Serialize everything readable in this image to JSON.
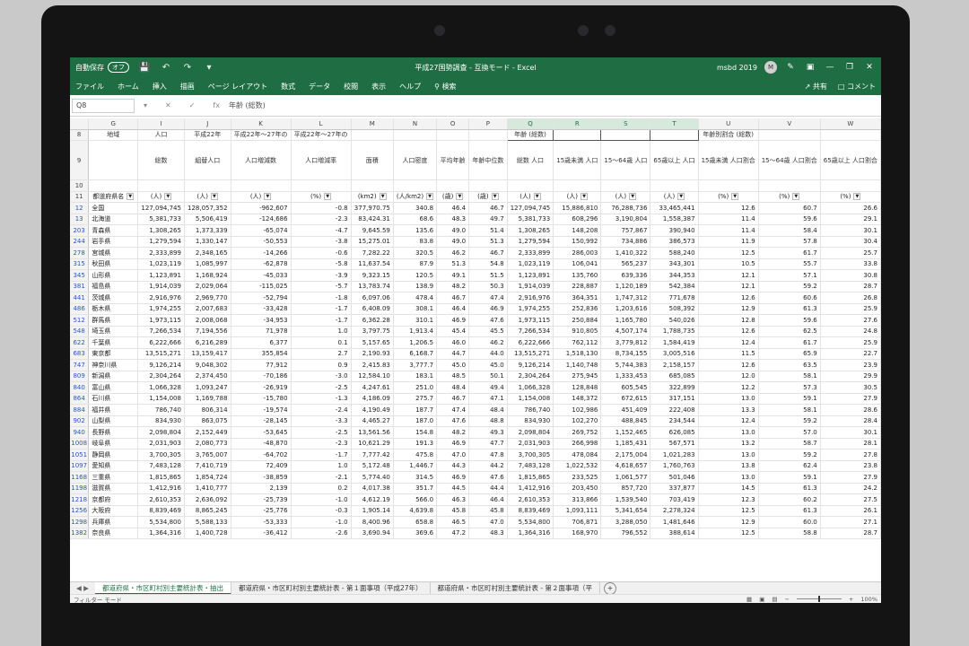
{
  "titlebar": {
    "autosave_label": "自動保存",
    "autosave_state": "オフ",
    "title": "平成27国勢調査 - 互換モード - Excel",
    "account": "msbd 2019",
    "avatar": "M"
  },
  "menu": {
    "items": [
      "ファイル",
      "ホーム",
      "挿入",
      "描画",
      "ページ レイアウト",
      "数式",
      "データ",
      "校閲",
      "表示",
      "ヘルプ",
      "検索"
    ],
    "share": "共有",
    "comment": "コメント"
  },
  "formula_bar": {
    "cell_ref": "Q8",
    "fx": "fx",
    "content": "年齢 (総数)"
  },
  "columns": [
    "G",
    "I",
    "J",
    "K",
    "L",
    "M",
    "N",
    "O",
    "P",
    "Q",
    "R",
    "S",
    "T",
    "U",
    "V",
    "W"
  ],
  "selected_columns": [
    "Q",
    "R",
    "S",
    "T"
  ],
  "header_rows": {
    "row8": {
      "num": "8",
      "cells": [
        "地域",
        "人口",
        "平成22年",
        "平成22年～27年の",
        "平成22年～27年の",
        "",
        "",
        "",
        "",
        "年齢 (総数)",
        "",
        "",
        "",
        "年齢別割合 (総数)",
        "",
        ""
      ]
    },
    "row9": {
      "num": "9",
      "cells": [
        "",
        "総数",
        "組替人口",
        "人口増減数",
        "人口増減率",
        "面積",
        "人口密度",
        "平均年齢",
        "年齢中位数",
        "総数 人口",
        "15歳未満 人口",
        "15～64歳 人口",
        "65歳以上 人口",
        "15歳未満 人口割合",
        "15～64歳 人口割合",
        "65歳以上 人口割合"
      ]
    },
    "row10": {
      "num": "10"
    },
    "row11": {
      "num": "11",
      "cells": [
        "都道府県名",
        "(人)",
        "(人)",
        "(人)",
        "(%)",
        "(km2)",
        "(人/km2)",
        "(歳)",
        "(歳)",
        "(人)",
        "(人)",
        "(人)",
        "(人)",
        "(%)",
        "(%)",
        "(%)"
      ]
    }
  },
  "rows": [
    [
      "12",
      "全国",
      "127,094,745",
      "128,057,352",
      "-962,607",
      "-0.8",
      "377,970.75",
      "340.8",
      "46.4",
      "46.7",
      "127,094,745",
      "15,886,810",
      "76,288,736",
      "33,465,441",
      "12.6",
      "60.7",
      "26.6"
    ],
    [
      "13",
      "北海道",
      "5,381,733",
      "5,506,419",
      "-124,686",
      "-2.3",
      "83,424.31",
      "68.6",
      "48.3",
      "49.7",
      "5,381,733",
      "608,296",
      "3,190,804",
      "1,558,387",
      "11.4",
      "59.6",
      "29.1"
    ],
    [
      "203",
      "青森県",
      "1,308,265",
      "1,373,339",
      "-65,074",
      "-4.7",
      "9,645.59",
      "135.6",
      "49.0",
      "51.4",
      "1,308,265",
      "148,208",
      "757,867",
      "390,940",
      "11.4",
      "58.4",
      "30.1"
    ],
    [
      "244",
      "岩手県",
      "1,279,594",
      "1,330,147",
      "-50,553",
      "-3.8",
      "15,275.01",
      "83.8",
      "49.0",
      "51.3",
      "1,279,594",
      "150,992",
      "734,886",
      "386,573",
      "11.9",
      "57.8",
      "30.4"
    ],
    [
      "278",
      "宮城県",
      "2,333,899",
      "2,348,165",
      "-14,266",
      "-0.6",
      "7,282.22",
      "320.5",
      "46.2",
      "46.7",
      "2,333,899",
      "286,003",
      "1,410,322",
      "588,240",
      "12.5",
      "61.7",
      "25.7"
    ],
    [
      "315",
      "秋田県",
      "1,023,119",
      "1,085,997",
      "-62,878",
      "-5.8",
      "11,637.54",
      "87.9",
      "51.3",
      "54.8",
      "1,023,119",
      "106,041",
      "565,237",
      "343,301",
      "10.5",
      "55.7",
      "33.8"
    ],
    [
      "345",
      "山形県",
      "1,123,891",
      "1,168,924",
      "-45,033",
      "-3.9",
      "9,323.15",
      "120.5",
      "49.1",
      "51.5",
      "1,123,891",
      "135,760",
      "639,336",
      "344,353",
      "12.1",
      "57.1",
      "30.8"
    ],
    [
      "381",
      "福島県",
      "1,914,039",
      "2,029,064",
      "-115,025",
      "-5.7",
      "13,783.74",
      "138.9",
      "48.2",
      "50.3",
      "1,914,039",
      "228,887",
      "1,120,189",
      "542,384",
      "12.1",
      "59.2",
      "28.7"
    ],
    [
      "441",
      "茨城県",
      "2,916,976",
      "2,969,770",
      "-52,794",
      "-1.8",
      "6,097.06",
      "478.4",
      "46.7",
      "47.4",
      "2,916,976",
      "364,351",
      "1,747,312",
      "771,678",
      "12.6",
      "60.6",
      "26.8"
    ],
    [
      "486",
      "栃木県",
      "1,974,255",
      "2,007,683",
      "-33,428",
      "-1.7",
      "6,408.09",
      "308.1",
      "46.4",
      "46.9",
      "1,974,255",
      "252,836",
      "1,203,616",
      "508,392",
      "12.9",
      "61.3",
      "25.9"
    ],
    [
      "512",
      "群馬県",
      "1,973,115",
      "2,008,068",
      "-34,953",
      "-1.7",
      "6,362.28",
      "310.1",
      "46.9",
      "47.6",
      "1,973,115",
      "250,884",
      "1,165,780",
      "540,026",
      "12.8",
      "59.6",
      "27.6"
    ],
    [
      "548",
      "埼玉県",
      "7,266,534",
      "7,194,556",
      "71,978",
      "1.0",
      "3,797.75",
      "1,913.4",
      "45.4",
      "45.5",
      "7,266,534",
      "910,805",
      "4,507,174",
      "1,788,735",
      "12.6",
      "62.5",
      "24.8"
    ],
    [
      "622",
      "千葉県",
      "6,222,666",
      "6,216,289",
      "6,377",
      "0.1",
      "5,157.65",
      "1,206.5",
      "46.0",
      "46.2",
      "6,222,666",
      "762,112",
      "3,779,812",
      "1,584,419",
      "12.4",
      "61.7",
      "25.9"
    ],
    [
      "683",
      "東京都",
      "13,515,271",
      "13,159,417",
      "355,854",
      "2.7",
      "2,190.93",
      "6,168.7",
      "44.7",
      "44.0",
      "13,515,271",
      "1,518,130",
      "8,734,155",
      "3,005,516",
      "11.5",
      "65.9",
      "22.7"
    ],
    [
      "747",
      "神奈川県",
      "9,126,214",
      "9,048,302",
      "77,912",
      "0.9",
      "2,415.83",
      "3,777.7",
      "45.0",
      "45.0",
      "9,126,214",
      "1,140,748",
      "5,744,383",
      "2,158,157",
      "12.6",
      "63.5",
      "23.9"
    ],
    [
      "809",
      "新潟県",
      "2,304,264",
      "2,374,450",
      "-70,186",
      "-3.0",
      "12,584.10",
      "183.1",
      "48.5",
      "50.1",
      "2,304,264",
      "275,945",
      "1,333,453",
      "685,085",
      "12.0",
      "58.1",
      "29.9"
    ],
    [
      "840",
      "富山県",
      "1,066,328",
      "1,093,247",
      "-26,919",
      "-2.5",
      "4,247.61",
      "251.0",
      "48.4",
      "49.4",
      "1,066,328",
      "128,848",
      "605,545",
      "322,899",
      "12.2",
      "57.3",
      "30.5"
    ],
    [
      "864",
      "石川県",
      "1,154,008",
      "1,169,788",
      "-15,780",
      "-1.3",
      "4,186.09",
      "275.7",
      "46.7",
      "47.1",
      "1,154,008",
      "148,372",
      "672,615",
      "317,151",
      "13.0",
      "59.1",
      "27.9"
    ],
    [
      "884",
      "福井県",
      "786,740",
      "806,314",
      "-19,574",
      "-2.4",
      "4,190.49",
      "187.7",
      "47.4",
      "48.4",
      "786,740",
      "102,986",
      "451,409",
      "222,408",
      "13.3",
      "58.1",
      "28.6"
    ],
    [
      "902",
      "山梨県",
      "834,930",
      "863,075",
      "-28,145",
      "-3.3",
      "4,465.27",
      "187.0",
      "47.6",
      "48.8",
      "834,930",
      "102,270",
      "488,845",
      "234,544",
      "12.4",
      "59.2",
      "28.4"
    ],
    [
      "940",
      "長野県",
      "2,098,804",
      "2,152,449",
      "-53,645",
      "-2.5",
      "13,561.56",
      "154.8",
      "48.2",
      "49.3",
      "2,098,804",
      "269,752",
      "1,152,465",
      "626,085",
      "13.0",
      "57.0",
      "30.1"
    ],
    [
      "1008",
      "岐阜県",
      "2,031,903",
      "2,080,773",
      "-48,870",
      "-2.3",
      "10,621.29",
      "191.3",
      "46.9",
      "47.7",
      "2,031,903",
      "266,998",
      "1,185,431",
      "567,571",
      "13.2",
      "58.7",
      "28.1"
    ],
    [
      "1051",
      "静岡県",
      "3,700,305",
      "3,765,007",
      "-64,702",
      "-1.7",
      "7,777.42",
      "475.8",
      "47.0",
      "47.8",
      "3,700,305",
      "478,084",
      "2,175,004",
      "1,021,283",
      "13.0",
      "59.2",
      "27.8"
    ],
    [
      "1097",
      "愛知県",
      "7,483,128",
      "7,410,719",
      "72,409",
      "1.0",
      "5,172.48",
      "1,446.7",
      "44.3",
      "44.2",
      "7,483,128",
      "1,022,532",
      "4,618,657",
      "1,760,763",
      "13.8",
      "62.4",
      "23.8"
    ],
    [
      "1168",
      "三重県",
      "1,815,865",
      "1,854,724",
      "-38,859",
      "-2.1",
      "5,774.40",
      "314.5",
      "46.9",
      "47.6",
      "1,815,865",
      "233,525",
      "1,061,577",
      "501,046",
      "13.0",
      "59.1",
      "27.9"
    ],
    [
      "1198",
      "滋賀県",
      "1,412,916",
      "1,410,777",
      "2,139",
      "0.2",
      "4,017.38",
      "351.7",
      "44.5",
      "44.4",
      "1,412,916",
      "203,450",
      "857,720",
      "337,877",
      "14.5",
      "61.3",
      "24.2"
    ],
    [
      "1218",
      "京都府",
      "2,610,353",
      "2,636,092",
      "-25,739",
      "-1.0",
      "4,612.19",
      "566.0",
      "46.3",
      "46.4",
      "2,610,353",
      "313,866",
      "1,539,540",
      "703,419",
      "12.3",
      "60.2",
      "27.5"
    ],
    [
      "1256",
      "大阪府",
      "8,839,469",
      "8,865,245",
      "-25,776",
      "-0.3",
      "1,905.14",
      "4,639.8",
      "45.8",
      "45.8",
      "8,839,469",
      "1,093,111",
      "5,341,654",
      "2,278,324",
      "12.5",
      "61.3",
      "26.1"
    ],
    [
      "1298",
      "兵庫県",
      "5,534,800",
      "5,588,133",
      "-53,333",
      "-1.0",
      "8,400.96",
      "658.8",
      "46.5",
      "47.0",
      "5,534,800",
      "706,871",
      "3,288,050",
      "1,481,646",
      "12.9",
      "60.0",
      "27.1"
    ],
    [
      "1382",
      "奈良県",
      "1,364,316",
      "1,400,728",
      "-36,412",
      "-2.6",
      "3,690.94",
      "369.6",
      "47.2",
      "48.3",
      "1,364,316",
      "168,970",
      "796,552",
      "388,614",
      "12.5",
      "58.8",
      "28.7"
    ]
  ],
  "sheet_tabs": [
    "都道府県・市区町村別主要統計表・抽出",
    "都道府県・市区町村別主要統計表 - 第１面事項（平成27年）",
    "都道府県・市区町村別主要統計表 - 第２面事項（平"
  ],
  "status": {
    "mode": "フィルター モード",
    "zoom": "100%"
  },
  "colors": {
    "excel_green": "#1f6e43",
    "row_number_blue": "#2b55c0"
  }
}
